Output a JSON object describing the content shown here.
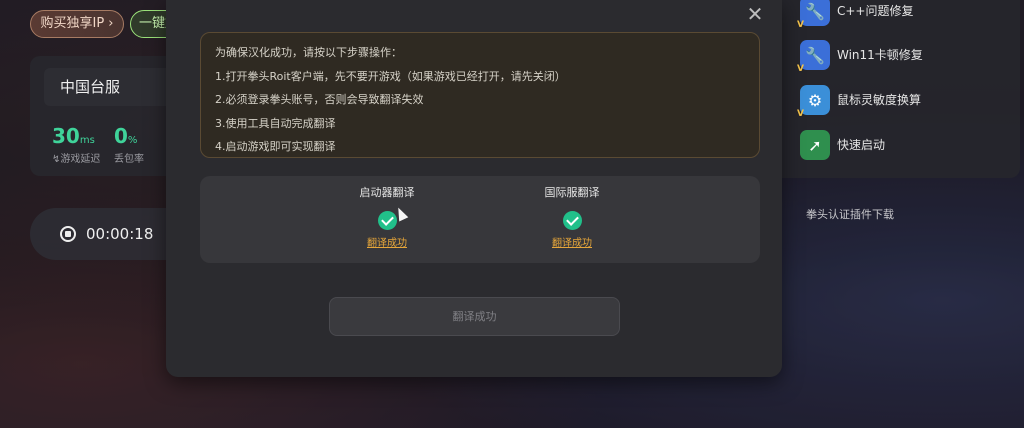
{
  "app": {
    "buy_ip_label": "购买独享IP ›",
    "one_key_label": "一键加速"
  },
  "status": {
    "server": "中国台服",
    "latency_value": "30",
    "latency_unit": "ms",
    "latency_label": "游戏延迟",
    "loss_value": "0",
    "loss_unit": "%",
    "loss_label": "丢包率",
    "timer": "00:00:18"
  },
  "tools": [
    {
      "label": "C++问题修复",
      "icon": "wrench-icon",
      "color": "#3b6fd8"
    },
    {
      "label": "Win11卡顿修复",
      "icon": "wrench-icon",
      "color": "#3b6fd8"
    },
    {
      "label": "鼠标灵敏度换算",
      "icon": "gear-icon",
      "color": "#3b8fd8"
    },
    {
      "label": "快速启动",
      "icon": "launch-icon",
      "color": "#2f8f4e"
    }
  ],
  "plugin_link": "拳头认证插件下载",
  "dialog": {
    "close_icon": "close-icon",
    "notice": [
      "为确保汉化成功，请按以下步骤操作：",
      "1.打开拳头Roit客户端，先不要开游戏（如果游戏已经打开，请先关闭）",
      "2.必须登录拳头账号，否则会导致翻译失效",
      "3.使用工具自动完成翻译",
      "4.启动游戏即可实现翻译"
    ],
    "launcher_title": "启动器翻译",
    "launcher_status": "翻译成功",
    "intl_title": "国际服翻译",
    "intl_status": "翻译成功",
    "action_button": "翻译成功"
  },
  "colors": {
    "accent_green": "#21c08a",
    "status_orange": "#e6a63a",
    "stat_green": "#3fd39a"
  }
}
